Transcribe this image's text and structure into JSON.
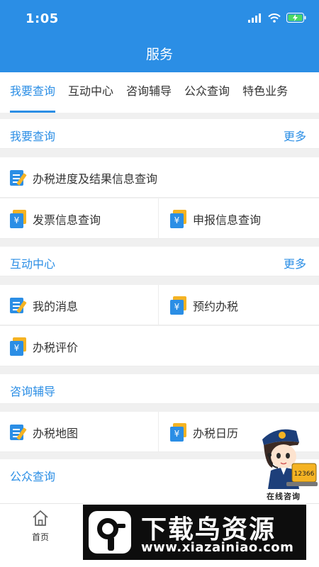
{
  "status_bar": {
    "time": "1:05"
  },
  "header": {
    "title": "服务"
  },
  "tabs": [
    {
      "label": "我要查询",
      "active": true
    },
    {
      "label": "互动中心",
      "active": false
    },
    {
      "label": "咨询辅导",
      "active": false
    },
    {
      "label": "公众查询",
      "active": false
    },
    {
      "label": "特色业务",
      "active": false
    }
  ],
  "sections": {
    "query": {
      "title": "我要查询",
      "more": "更多",
      "items": [
        {
          "label": "办税进度及结果信息查询",
          "icon": "edit-doc-icon"
        },
        {
          "label": "发票信息查询",
          "icon": "yen-card-icon"
        },
        {
          "label": "申报信息查询",
          "icon": "yen-card-icon"
        }
      ]
    },
    "interaction": {
      "title": "互动中心",
      "more": "更多",
      "items": [
        {
          "label": "我的消息",
          "icon": "edit-doc-icon"
        },
        {
          "label": "预约办税",
          "icon": "yen-card-icon"
        },
        {
          "label": "办税评价",
          "icon": "yen-card-icon"
        }
      ]
    },
    "consult": {
      "title": "咨询辅导",
      "items": [
        {
          "label": "办税地图",
          "icon": "edit-doc-icon"
        },
        {
          "label": "办税日历",
          "icon": "yen-card-icon"
        }
      ]
    },
    "public": {
      "title": "公众查询"
    }
  },
  "bottom_nav": {
    "home_label": "首页"
  },
  "floating_help": {
    "label": "在线咨询",
    "hotline": "12366"
  },
  "watermark": {
    "title": "下载鸟资源",
    "url": "www.xiazainiao.com"
  },
  "colors": {
    "accent": "#2b8ee5",
    "icon_yellow": "#f5b323",
    "background": "#f0f0f0"
  }
}
